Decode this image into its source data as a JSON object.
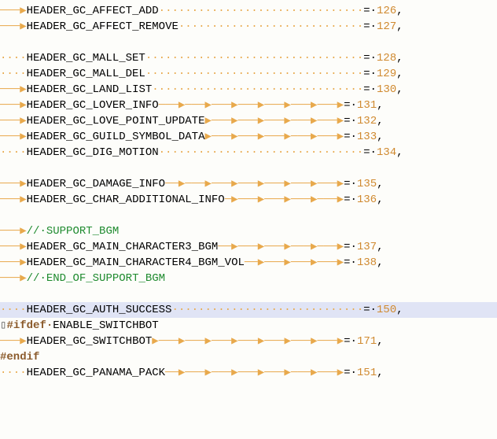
{
  "lines": {
    "l1": {
      "lead": "───▶",
      "name": "HEADER_GC_AFFECT_ADD",
      "fill": "·······························",
      "eq": "=·",
      "num": "126",
      "tail": ","
    },
    "l2": {
      "lead": "───▶",
      "name": "HEADER_GC_AFFECT_REMOVE",
      "fill": "····························",
      "eq": "=·",
      "num": "127",
      "tail": ","
    },
    "l3": {
      "lead": "····",
      "name": "HEADER_GC_MALL_SET",
      "fill": "·································",
      "eq": "=·",
      "num": "128",
      "tail": ","
    },
    "l4": {
      "lead": "····",
      "name": "HEADER_GC_MALL_DEL",
      "fill": "·································",
      "eq": "=·",
      "num": "129",
      "tail": ","
    },
    "l5": {
      "lead": "───▶",
      "name": "HEADER_GC_LAND_LIST",
      "fill": "································",
      "eq": "=·",
      "num": "130",
      "tail": ","
    },
    "l6": {
      "lead": "───▶",
      "name": "HEADER_GC_LOVER_INFO",
      "fill": "───▶───▶───▶───▶───▶───▶───▶",
      "eq": "=·",
      "num": "131",
      "tail": ","
    },
    "l7": {
      "lead": "───▶",
      "name": "HEADER_GC_LOVE_POINT_UPDATE",
      "fill": "▶───▶───▶───▶───▶───▶",
      "eq": "=·",
      "num": "132",
      "tail": ","
    },
    "l8": {
      "lead": "───▶",
      "name": "HEADER_GC_GUILD_SYMBOL_DATA",
      "fill": "▶───▶───▶───▶───▶───▶",
      "eq": "=·",
      "num": "133",
      "tail": ","
    },
    "l9": {
      "lead": "····",
      "name": "HEADER_GC_DIG_MOTION",
      "fill": "·······························",
      "eq": "=·",
      "num": "134",
      "tail": ","
    },
    "l10": {
      "lead": "───▶",
      "name": "HEADER_GC_DAMAGE_INFO",
      "fill": "──▶───▶───▶───▶───▶───▶───▶",
      "eq": "=·",
      "num": "135",
      "tail": ","
    },
    "l11": {
      "lead": "───▶",
      "name": "HEADER_GC_CHAR_ADDITIONAL_INFO",
      "fill": "─▶───▶───▶───▶───▶",
      "eq": "=·",
      "num": "136",
      "tail": ","
    },
    "l12": {
      "lead": "───▶",
      "comment": "//·SUPPORT_BGM"
    },
    "l13": {
      "lead": "───▶",
      "name": "HEADER_GC_MAIN_CHARACTER3_BGM",
      "fill": "──▶───▶───▶───▶───▶",
      "eq": "=·",
      "num": "137",
      "tail": ","
    },
    "l14": {
      "lead": "───▶",
      "name": "HEADER_GC_MAIN_CHARACTER4_BGM_VOL",
      "fill": "──▶───▶───▶───▶",
      "eq": "=·",
      "num": "138",
      "tail": ","
    },
    "l15": {
      "lead": "───▶",
      "comment": "//·END_OF_SUPPORT_BGM"
    },
    "l16": {
      "lead": "····",
      "name": "HEADER_GC_AUTH_SUCCESS",
      "fill": "·····························",
      "eq": "=·",
      "num": "150",
      "tail": ","
    },
    "l17": {
      "preproc": "#ifdef·",
      "ident": "ENABLE_SWITCHBOT"
    },
    "l18": {
      "lead": "───▶",
      "name": "HEADER_GC_SWITCHBOT",
      "fill": "▶───▶───▶───▶───▶───▶───▶───▶",
      "eq": "=·",
      "num": "171",
      "tail": ","
    },
    "l19": {
      "preproc": "#endif"
    },
    "l20": {
      "lead": "····",
      "name": "HEADER_GC_PANAMA_PACK",
      "fill": "──▶───▶───▶───▶───▶───▶───▶",
      "eq": "=·",
      "num": "151",
      "tail": ","
    }
  }
}
